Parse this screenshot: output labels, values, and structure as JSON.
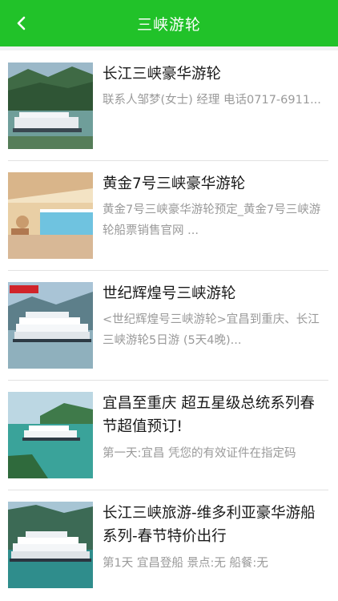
{
  "header": {
    "title": "三峡游轮",
    "back_icon": "chevron-left-icon"
  },
  "colors": {
    "header_bg": "#21c229",
    "title_text": "#1a1a1a",
    "desc_text": "#9a9a9a"
  },
  "items": [
    {
      "title": "长江三峡豪华游轮",
      "desc": "联系人邹梦(女士) 经理 电话0717-6911..."
    },
    {
      "title": "黄金7号三峡豪华游轮",
      "desc": "黄金7号三峡豪华游轮预定_黄金7号三峡游轮船票销售官网 ..."
    },
    {
      "title": "世纪辉煌号三峡游轮",
      "desc": "<世纪辉煌号三峡游轮>宜昌到重庆、长江三峡游轮5日游 (5天4晚)..."
    },
    {
      "title": "宜昌至重庆 超五星级总统系列春节超值预订!",
      "desc": "第一天:宜昌 凭您的有效证件在指定码"
    },
    {
      "title": "长江三峡旅游-维多利亚豪华游船系列-春节特价出行",
      "desc": "第1天 宜昌登船 景点:无 船餐:无"
    }
  ]
}
